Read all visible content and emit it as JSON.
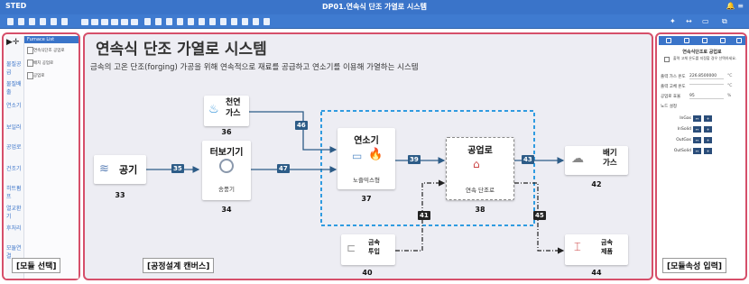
{
  "app": {
    "brand": "STED",
    "window_title": "DP01.연속식 단조 가열로 시스템"
  },
  "left_panel": {
    "categories": [
      "물질공급",
      "물질배출",
      "연소기",
      "보일러",
      "공업로",
      "건조기",
      "히트펌프",
      "열교환기",
      "후처리",
      "모듈연결"
    ],
    "list_header": "Furnace List",
    "items": [
      "연속식단조 공업로",
      "배치 공업로",
      "공업로"
    ],
    "label": "[모듈 선택]"
  },
  "canvas": {
    "title": "연속식 단조 가열로 시스템",
    "subtitle": "금속의 고온 단조(forging) 가공을 위해 연속적으로 재료를 공급하고 연소기를 이용해 가열하는 시스템",
    "label": "[공정설계 캔버스]",
    "nodes": {
      "air": {
        "label": "공기",
        "num": "33"
      },
      "natgas": {
        "line1": "천연",
        "line2": "가스",
        "num": "36"
      },
      "turbo": {
        "label": "터보기기",
        "sub": "송풍기",
        "num": "34"
      },
      "burner": {
        "label": "연소기",
        "sub": "노즐믹스형",
        "num": "37"
      },
      "furnace": {
        "label": "공업로",
        "sub": "연속 단조로",
        "num": "38"
      },
      "exhaust": {
        "line1": "배기",
        "line2": "가스",
        "num": "42"
      },
      "metal_in": {
        "line1": "금속",
        "line2": "투입",
        "num": "40"
      },
      "metal_out": {
        "line1": "금속",
        "line2": "제품",
        "num": "44"
      }
    },
    "connections": {
      "c35": "35",
      "c46": "46",
      "c47": "47",
      "c39": "39",
      "c43": "43",
      "c41": "41",
      "c45": "45"
    }
  },
  "right_panel": {
    "title": "연속식단조로 공업로",
    "note": "출력 고체 온도를 지정할 경우 선택하세요.",
    "rows": [
      {
        "label": "출력 가스 온도",
        "value": "226.8500000",
        "unit": "°C"
      },
      {
        "label": "출력 고체 온도",
        "value": "",
        "unit": "°C"
      },
      {
        "label": "공업로 효율",
        "value": "95",
        "unit": "%"
      },
      {
        "label": "노드 설정",
        "value": "",
        "unit": ""
      }
    ],
    "io": [
      "InGas",
      "InSolid",
      "OutGas",
      "OutSolid"
    ],
    "label": "[모듈속성 입력]"
  },
  "colors": {
    "accent": "#3a74c9",
    "panel_border": "#d64f6a",
    "connector": "#2d5c87",
    "highlight_box": "#2f9be0",
    "flame": "#e8542a"
  }
}
